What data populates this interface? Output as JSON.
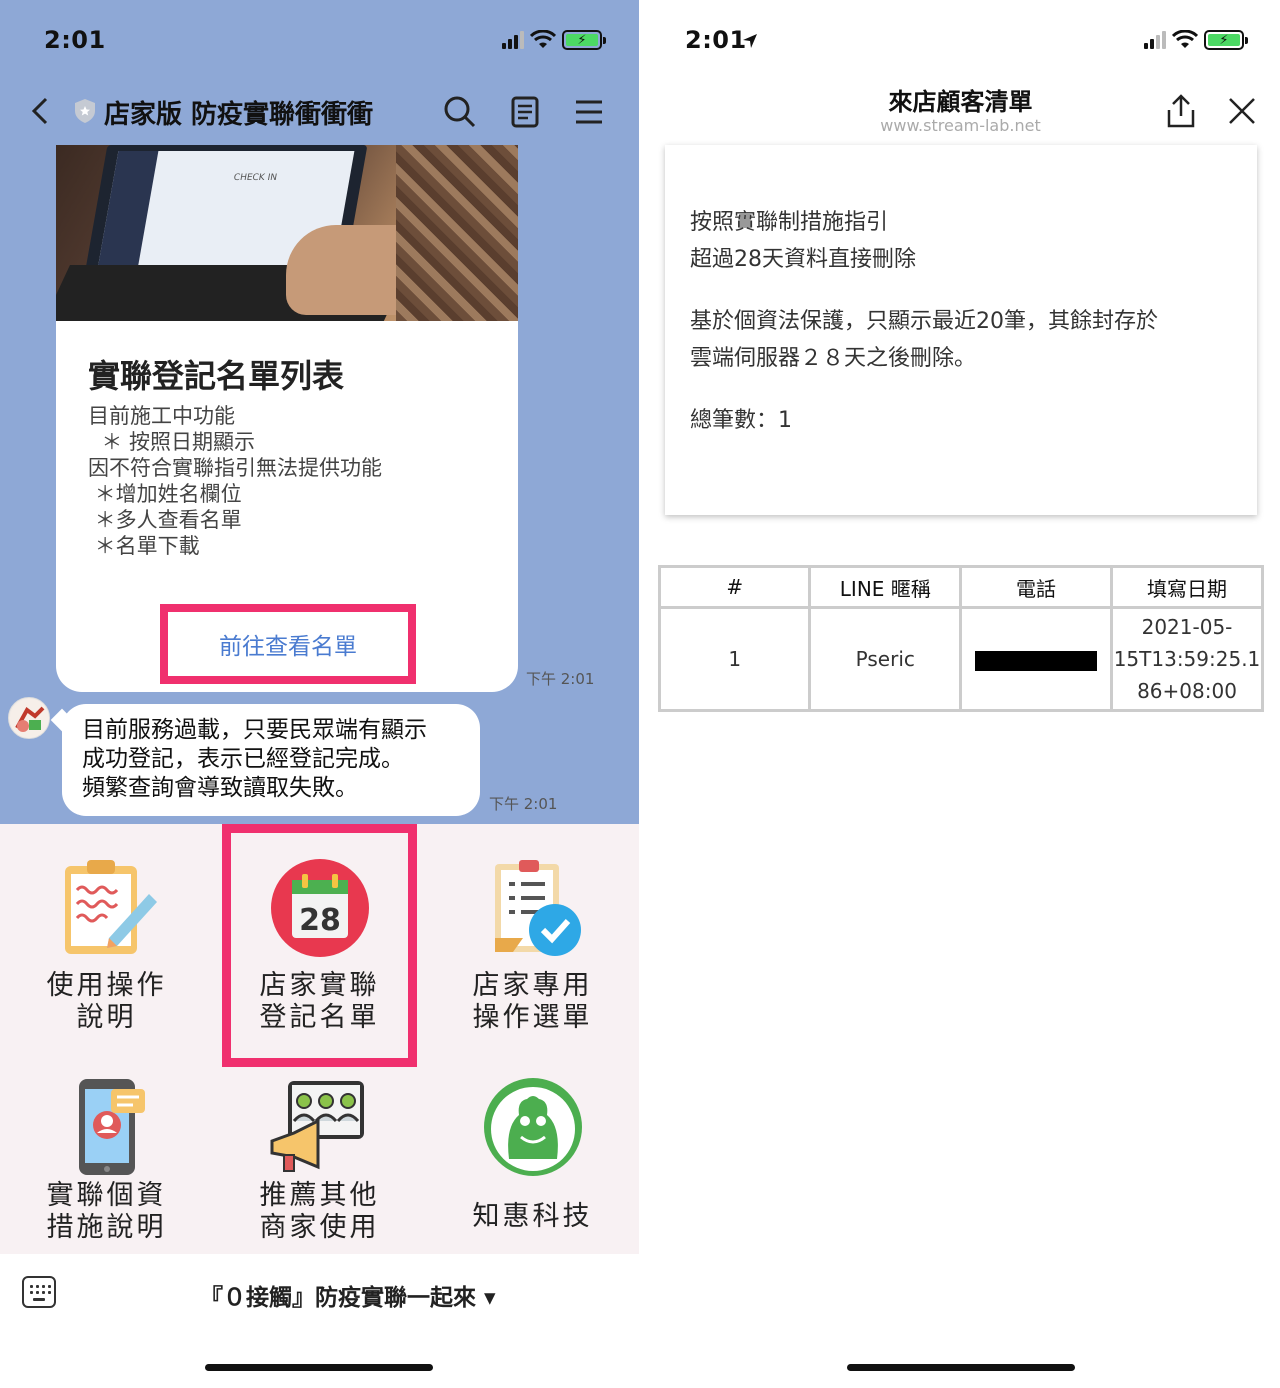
{
  "left_phone": {
    "status": {
      "time": "2:01"
    },
    "header": {
      "title": "店家版 防疫實聯衝衝衝"
    },
    "card": {
      "photo_text": "CHECK IN",
      "title": "實聯登記名單列表",
      "body_lines": [
        "目前施工中功能",
        "  ＊ 按照日期顯示",
        "因不符合實聯指引無法提供功能",
        " ＊增加姓名欄位",
        " ＊多人查看名單",
        " ＊名單下載"
      ],
      "link_label": "前往查看名單",
      "time": "下午 2:01"
    },
    "message": {
      "lines": [
        "目前服務過載，只要民眾端有顯示",
        "成功登記，表示已經登記完成。",
        "頻繁查詢會導致讀取失敗。"
      ],
      "time": "下午 2:01"
    },
    "rich_menu": {
      "items": [
        {
          "label": "使用操作\n說明",
          "icon": "clipboard-pencil-icon"
        },
        {
          "label": "店家實聯\n登記名單",
          "icon": "calendar-icon",
          "date": "28"
        },
        {
          "label": "店家專用\n操作選單",
          "icon": "checklist-icon"
        },
        {
          "label": "實聯個資\n措施說明",
          "icon": "phone-id-icon"
        },
        {
          "label": "推薦其他\n商家使用",
          "icon": "megaphone-people-icon"
        },
        {
          "label": "知惠科技",
          "icon": "frog-logo-icon"
        }
      ],
      "menu_title": "『０接觸』防疫實聯一起來 ▾"
    }
  },
  "right_phone": {
    "status": {
      "time": "2:01"
    },
    "header": {
      "title": "來店顧客清單",
      "url": "www.stream-lab.net"
    },
    "info": {
      "line1": "按照實聯制措施指引",
      "line2": "超過28天資料直接刪除",
      "line3": "基於個資法保護，只顯示最近20筆，其餘封存於",
      "line4": "雲端伺服器２８天之後刪除。",
      "line5": "總筆數：1"
    },
    "table": {
      "headers": [
        "#",
        "LINE 暱稱",
        "電話",
        "填寫日期"
      ],
      "rows": [
        {
          "num": "1",
          "nickname": "Pseric",
          "phone": "",
          "date_lines": [
            "2021-05-",
            "15T13:59:25.1",
            "86+08:00"
          ]
        }
      ]
    }
  },
  "colors": {
    "chat_bg": "#8ea8d6",
    "highlight": "#f0306e",
    "link": "#4a7bd0",
    "menu_bg": "#f8f1f3"
  }
}
